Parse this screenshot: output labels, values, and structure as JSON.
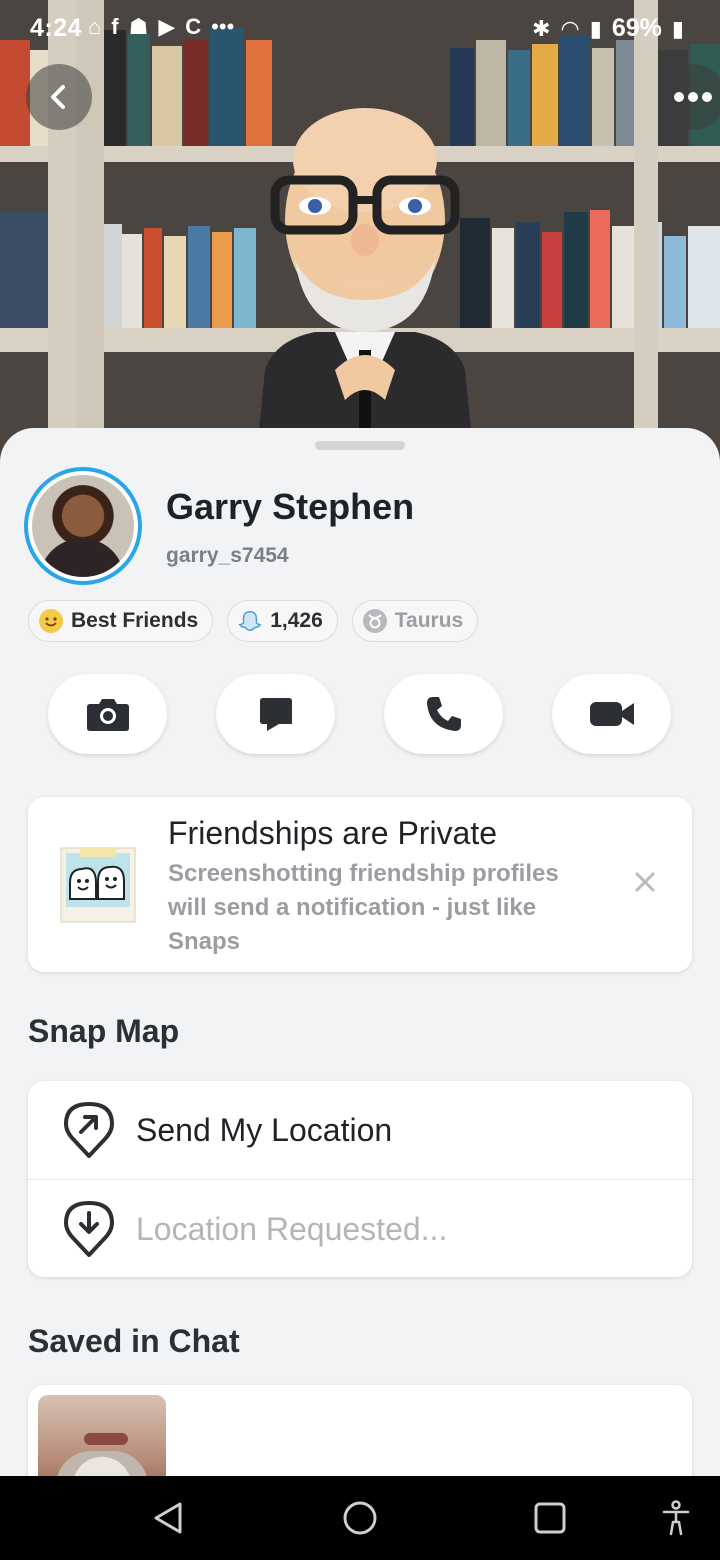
{
  "status_bar": {
    "time": "4:24",
    "battery": "69%"
  },
  "profile": {
    "name": "Garry Stephen",
    "username": "garry_s7454"
  },
  "chips": [
    {
      "label": "Best Friends",
      "icon": "smile-emoji-icon"
    },
    {
      "label": "1,426",
      "icon": "ghost-score-icon"
    },
    {
      "label": "Taurus",
      "icon": "taurus-icon"
    }
  ],
  "actions": [
    "camera-icon",
    "chat-icon",
    "phone-icon",
    "video-icon"
  ],
  "privacy_notice": {
    "title": "Friendships are Private",
    "body": "Screenshotting friendship profiles will send a notification - just like Snaps"
  },
  "snap_map": {
    "title": "Snap Map",
    "send_location": "Send My Location",
    "location_requested": "Location Requested..."
  },
  "saved_in_chat": {
    "title": "Saved in Chat"
  },
  "colors": {
    "accent_ring": "#2aa5e8",
    "sheet_bg": "#f2f3f5",
    "text_primary": "#1f2226",
    "text_muted": "#9a9da2"
  }
}
